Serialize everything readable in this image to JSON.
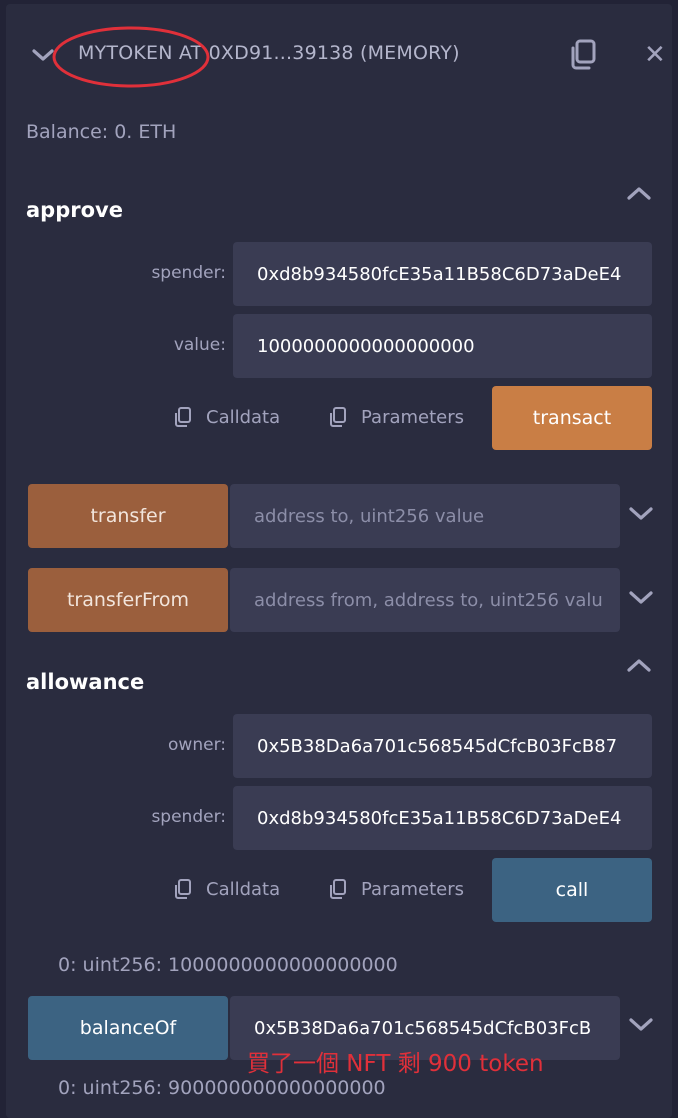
{
  "header": {
    "title": "MYTOKEN AT 0XD91...39138 (MEMORY)",
    "balance": "Balance: 0. ETH"
  },
  "approve": {
    "title": "approve",
    "spender_label": "spender:",
    "spender_value": "0xd8b934580fcE35a11B58C6D73aDeE4",
    "value_label": "value:",
    "value_value": "1000000000000000000",
    "calldata_label": "Calldata",
    "parameters_label": "Parameters",
    "action_label": "transact"
  },
  "transfer": {
    "label": "transfer",
    "placeholder": "address to, uint256 value"
  },
  "transferFrom": {
    "label": "transferFrom",
    "placeholder": "address from, address to, uint256 valu"
  },
  "allowance": {
    "title": "allowance",
    "owner_label": "owner:",
    "owner_value": "0x5B38Da6a701c568545dCfcB03FcB87",
    "spender_label": "spender:",
    "spender_value": "0xd8b934580fcE35a11B58C6D73aDeE4",
    "calldata_label": "Calldata",
    "parameters_label": "Parameters",
    "action_label": "call",
    "result": "0: uint256: 1000000000000000000"
  },
  "balanceOf": {
    "label": "balanceOf",
    "value": "0x5B38Da6a701c568545dCfcB03FcB",
    "annotation": "買了一個 NFT 剩 900 token",
    "result": "0: uint256: 900000000000000000"
  },
  "colors": {
    "background": "#222336",
    "panel": "#2a2c3f",
    "field": "#3a3c53",
    "transact_orange": "#c97e45",
    "function_brown": "#9b5f3d",
    "call_blue": "#3c6382",
    "annotation_red": "#e0303a"
  }
}
